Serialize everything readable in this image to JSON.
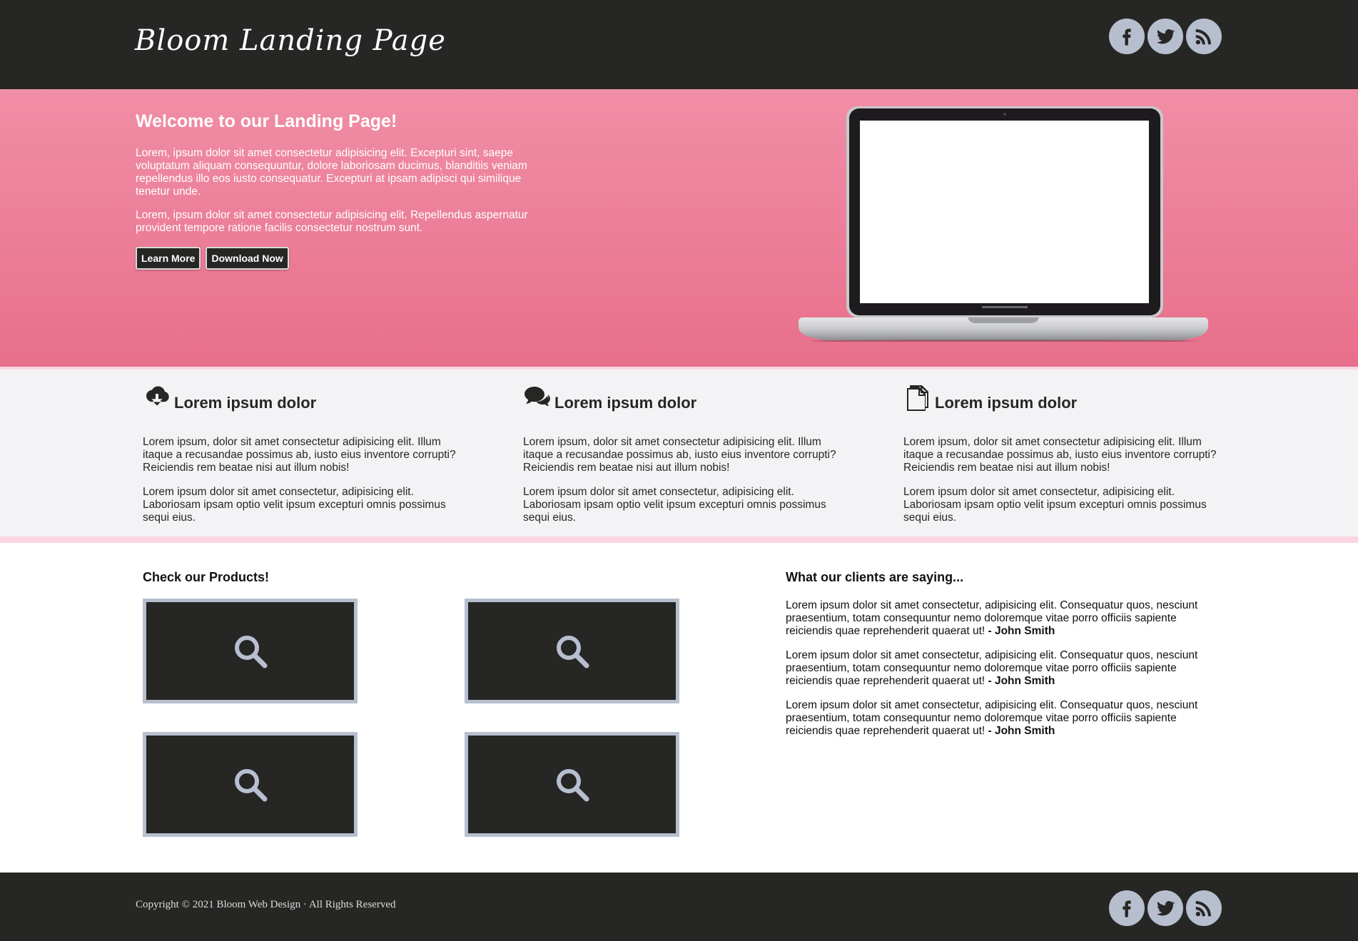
{
  "header": {
    "logo": "Bloom Landing Page",
    "social": [
      "facebook-icon",
      "twitter-icon",
      "rss-icon"
    ]
  },
  "hero": {
    "title": "Welcome to our Landing Page!",
    "paragraph1": "Lorem, ipsum dolor sit amet consectetur adipisicing elit. Excepturi sint, saepe voluptatum aliquam consequuntur, dolore laboriosam ducimus, blanditiis veniam repellendus illo eos iusto consequatur. Excepturi at ipsam adipisci qui similique tenetur unde.",
    "paragraph2": "Lorem, ipsum dolor sit amet consectetur adipisicing elit. Repellendus aspernatur provident tempore ratione facilis consectetur nostrum sunt.",
    "learn_more": "Learn More",
    "download_now": "Download Now"
  },
  "features": [
    {
      "icon": "cloud-download-icon",
      "title": "Lorem ipsum dolor",
      "p1": "Lorem ipsum, dolor sit amet consectetur adipisicing elit. Illum itaque a recusandae possimus ab, iusto eius inventore corrupti? Reiciendis rem beatae nisi aut illum nobis!",
      "p2": "Lorem ipsum dolor sit amet consectetur, adipisicing elit. Laboriosam ipsam optio velit ipsum excepturi omnis possimus sequi eius."
    },
    {
      "icon": "chat-bubbles-icon",
      "title": "Lorem ipsum dolor",
      "p1": "Lorem ipsum, dolor sit amet consectetur adipisicing elit. Illum itaque a recusandae possimus ab, iusto eius inventore corrupti? Reiciendis rem beatae nisi aut illum nobis!",
      "p2": "Lorem ipsum dolor sit amet consectetur, adipisicing elit. Laboriosam ipsam optio velit ipsum excepturi omnis possimus sequi eius."
    },
    {
      "icon": "document-icon",
      "title": "Lorem ipsum dolor",
      "p1": "Lorem ipsum, dolor sit amet consectetur adipisicing elit. Illum itaque a recusandae possimus ab, iusto eius inventore corrupti? Reiciendis rem beatae nisi aut illum nobis!",
      "p2": "Lorem ipsum dolor sit amet consectetur, adipisicing elit. Laboriosam ipsam optio velit ipsum excepturi omnis possimus sequi eius."
    }
  ],
  "products": {
    "title": "Check our Products!",
    "items": [
      "search-icon",
      "search-icon",
      "search-icon",
      "search-icon"
    ]
  },
  "clients": {
    "title": "What our clients are saying...",
    "testimonials": [
      {
        "text": "Lorem ipsum dolor sit amet consectetur, adipisicing elit. Consequatur quos, nesciunt praesentium, totam consequuntur nemo doloremque vitae porro officiis sapiente reiciendis quae reprehenderit quaerat ut!",
        "author": "- John Smith"
      },
      {
        "text": "Lorem ipsum dolor sit amet consectetur, adipisicing elit. Consequatur quos, nesciunt praesentium, totam consequuntur nemo doloremque vitae porro officiis sapiente reiciendis quae reprehenderit quaerat ut!",
        "author": "- John Smith"
      },
      {
        "text": "Lorem ipsum dolor sit amet consectetur, adipisicing elit. Consequatur quos, nesciunt praesentium, totam consequuntur nemo doloremque vitae porro officiis sapiente reiciendis quae reprehenderit quaerat ut!",
        "author": "- John Smith"
      }
    ]
  },
  "footer": {
    "copyright": "Copyright © 2021 Bloom Web Design · All Rights Reserved",
    "social": [
      "facebook-icon",
      "twitter-icon",
      "rss-icon"
    ]
  },
  "colors": {
    "dark": "#262624",
    "pink_top": "#f08ea6",
    "pink_bottom": "#e86f8c",
    "icon_grey": "#b7bfcf",
    "feature_bg": "#f3f3f5",
    "pink_border": "#fbd6e2"
  }
}
